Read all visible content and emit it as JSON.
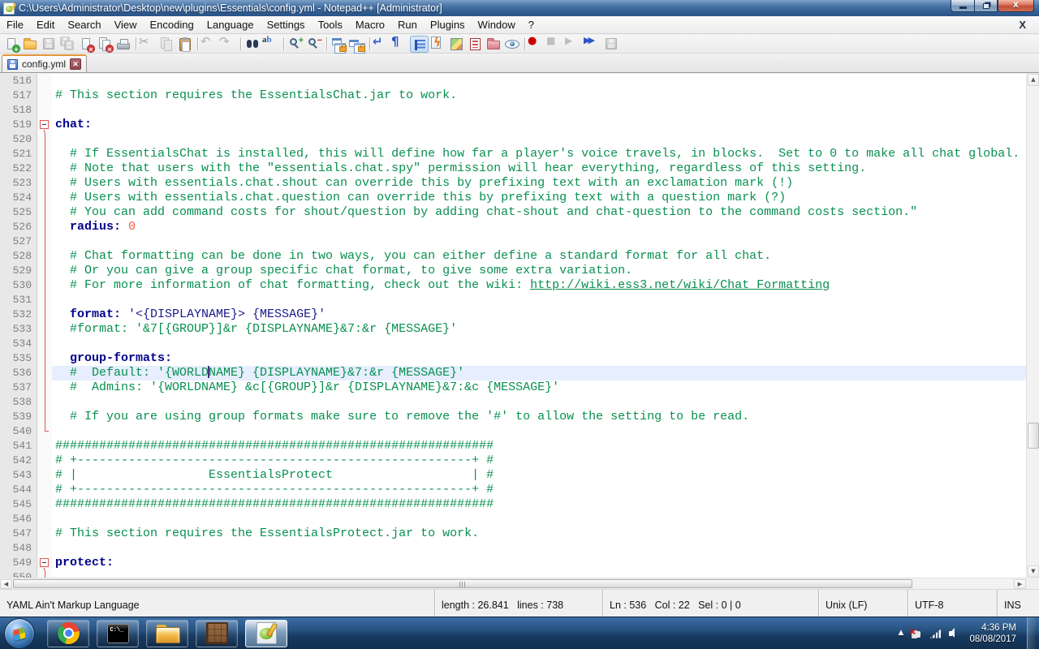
{
  "window": {
    "title": "C:\\Users\\Administrator\\Desktop\\new\\plugins\\Essentials\\config.yml - Notepad++ [Administrator]",
    "icon": "notepad-plus-plus",
    "controls": [
      "minimize",
      "restore",
      "close"
    ]
  },
  "menu": {
    "items": [
      "File",
      "Edit",
      "Search",
      "View",
      "Encoding",
      "Language",
      "Settings",
      "Tools",
      "Macro",
      "Run",
      "Plugins",
      "Window",
      "?"
    ],
    "doc_close_label": "X"
  },
  "toolbar": {
    "items": [
      "new-file",
      "open-file",
      "save",
      "save-all",
      "close",
      "close-all",
      "print",
      "separator",
      "cut",
      "copy",
      "paste",
      "separator",
      "undo",
      "redo",
      "separator",
      "find",
      "replace",
      "separator",
      "zoom-in",
      "zoom-out",
      "separator",
      "sync-scroll-vertical",
      "sync-scroll-horizontal",
      "separator",
      "word-wrap",
      "show-all-characters",
      "show-indent-guide",
      "function-list",
      "document-map",
      "document-list",
      "folder-as-workspace",
      "file-monitoring",
      "separator",
      "macro-record",
      "macro-stop",
      "macro-playback",
      "macro-run-multiple",
      "macro-save"
    ],
    "disabled": [
      "save",
      "save-all",
      "cut",
      "copy",
      "undo",
      "redo",
      "macro-stop",
      "macro-playback",
      "macro-save"
    ],
    "pressed": [
      "show-indent-guide"
    ]
  },
  "tab": {
    "label": "config.yml",
    "save_state": "saved",
    "close_icon": "x"
  },
  "editor": {
    "language": "yaml",
    "current_line": 536,
    "caret": {
      "line": 536,
      "col": 22
    },
    "colors": {
      "comment": "#089050",
      "key": "#00008b",
      "string": "#1a1a8c",
      "number": "#ff5b3b",
      "current_line_bg": "#e6eeff",
      "fold_mark": "#e05555"
    },
    "lines": [
      {
        "n": 516,
        "segs": []
      },
      {
        "n": 517,
        "segs": [
          [
            "c",
            "# This section requires the EssentialsChat.jar to work."
          ]
        ]
      },
      {
        "n": 518,
        "segs": []
      },
      {
        "n": 519,
        "fold": "box",
        "segs": [
          [
            "k",
            "chat:"
          ]
        ]
      },
      {
        "n": 520,
        "fold": "line",
        "segs": []
      },
      {
        "n": 521,
        "fold": "line",
        "segs": [
          [
            "c",
            "  # If EssentialsChat is installed, this will define how far a player's voice travels, in blocks.  Set to 0 to make all chat global."
          ]
        ]
      },
      {
        "n": 522,
        "fold": "line",
        "segs": [
          [
            "c",
            "  # Note that users with the \"essentials.chat.spy\" permission will hear everything, regardless of this setting."
          ]
        ]
      },
      {
        "n": 523,
        "fold": "line",
        "segs": [
          [
            "c",
            "  # Users with essentials.chat.shout can override this by prefixing text with an exclamation mark (!)"
          ]
        ]
      },
      {
        "n": 524,
        "fold": "line",
        "segs": [
          [
            "c",
            "  # Users with essentials.chat.question can override this by prefixing text with a question mark (?)"
          ]
        ]
      },
      {
        "n": 525,
        "fold": "line",
        "segs": [
          [
            "c",
            "  # You can add command costs for shout/question by adding chat-shout and chat-question to the command costs section.\""
          ]
        ]
      },
      {
        "n": 526,
        "fold": "line",
        "segs": [
          [
            "k",
            "  radius:"
          ],
          [
            "t",
            " "
          ],
          [
            "n",
            "0"
          ]
        ]
      },
      {
        "n": 527,
        "fold": "line",
        "segs": []
      },
      {
        "n": 528,
        "fold": "line",
        "segs": [
          [
            "c",
            "  # Chat formatting can be done in two ways, you can either define a standard format for all chat."
          ]
        ]
      },
      {
        "n": 529,
        "fold": "line",
        "segs": [
          [
            "c",
            "  # Or you can give a group specific chat format, to give some extra variation."
          ]
        ]
      },
      {
        "n": 530,
        "fold": "line",
        "segs": [
          [
            "c",
            "  # For more information of chat formatting, check out the wiki: "
          ],
          [
            "lnk",
            "http://wiki.ess3.net/wiki/Chat_Formatting"
          ]
        ]
      },
      {
        "n": 531,
        "fold": "line",
        "segs": []
      },
      {
        "n": 532,
        "fold": "line",
        "segs": [
          [
            "k",
            "  format:"
          ],
          [
            "t",
            " "
          ],
          [
            "v",
            "'<{DISPLAYNAME}> {MESSAGE}'"
          ]
        ]
      },
      {
        "n": 533,
        "fold": "line",
        "segs": [
          [
            "c",
            "  #format: '&7[{GROUP}]&r {DISPLAYNAME}&7:&r {MESSAGE}'"
          ]
        ]
      },
      {
        "n": 534,
        "fold": "line",
        "segs": []
      },
      {
        "n": 535,
        "fold": "line",
        "segs": [
          [
            "k",
            "  group-formats:"
          ]
        ]
      },
      {
        "n": 536,
        "fold": "line",
        "segs": [
          [
            "c",
            "  #  Default: '{WORLD"
          ],
          [
            "caret",
            ""
          ],
          [
            "c",
            "NAME} {DISPLAYNAME}&7:&r {MESSAGE}'"
          ]
        ]
      },
      {
        "n": 537,
        "fold": "line",
        "segs": [
          [
            "c",
            "  #  Admins: '{WORLDNAME} &c[{GROUP}]&r {DISPLAYNAME}&7:&c {MESSAGE}'"
          ]
        ]
      },
      {
        "n": 538,
        "fold": "line",
        "segs": []
      },
      {
        "n": 539,
        "fold": "line",
        "segs": [
          [
            "c",
            "  # If you are using group formats make sure to remove the '#' to allow the setting to be read."
          ]
        ]
      },
      {
        "n": 540,
        "fold": "corner",
        "segs": []
      },
      {
        "n": 541,
        "segs": [
          [
            "c",
            "############################################################"
          ]
        ]
      },
      {
        "n": 542,
        "segs": [
          [
            "c",
            "# +------------------------------------------------------+ #"
          ]
        ]
      },
      {
        "n": 543,
        "segs": [
          [
            "c",
            "# |                  EssentialsProtect                   | #"
          ]
        ]
      },
      {
        "n": 544,
        "segs": [
          [
            "c",
            "# +------------------------------------------------------+ #"
          ]
        ]
      },
      {
        "n": 545,
        "segs": [
          [
            "c",
            "############################################################"
          ]
        ]
      },
      {
        "n": 546,
        "segs": []
      },
      {
        "n": 547,
        "segs": [
          [
            "c",
            "# This section requires the EssentialsProtect.jar to work."
          ]
        ]
      },
      {
        "n": 548,
        "segs": []
      },
      {
        "n": 549,
        "fold": "box",
        "segs": [
          [
            "k",
            "protect:"
          ]
        ]
      },
      {
        "n": 550,
        "fold": "line",
        "segs": []
      }
    ]
  },
  "status": {
    "doc_type": "YAML Ain't Markup Language",
    "length_info": "length : 26.841   lines : 738",
    "cursor_info": "Ln : 536   Col : 22   Sel : 0 | 0",
    "eol": "Unix (LF)",
    "encoding": "UTF-8",
    "insert_mode": "INS"
  },
  "taskbar": {
    "start": "start-orb",
    "buttons": [
      {
        "name": "chrome",
        "active": false
      },
      {
        "name": "cmd",
        "active": false
      },
      {
        "name": "explorer",
        "active": false
      },
      {
        "name": "minecraft",
        "active": false
      },
      {
        "name": "notepad-plus-plus",
        "active": true
      }
    ],
    "tray": {
      "icons": [
        "hidden-icons",
        "power",
        "network",
        "volume"
      ],
      "time": "4:36 PM",
      "date": "08/08/2017"
    }
  }
}
